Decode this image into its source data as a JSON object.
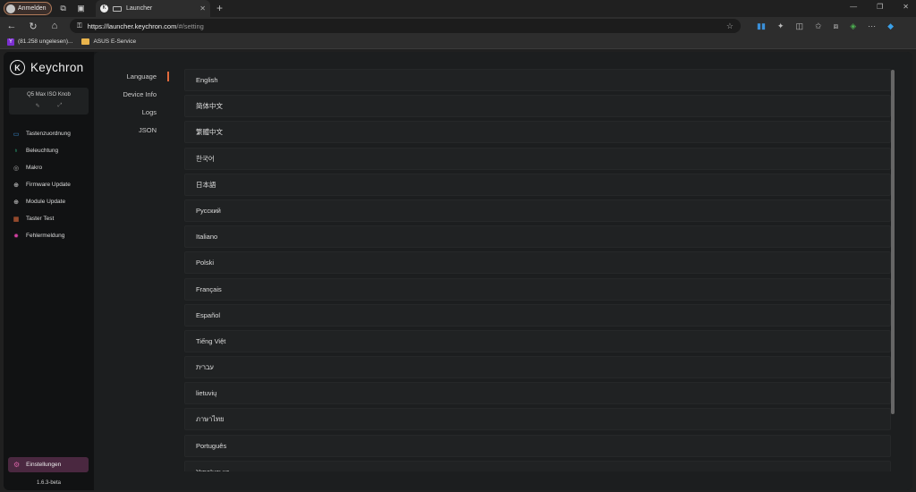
{
  "browser": {
    "profile_label": "Anmelden",
    "tab_title": "Launcher",
    "url_host": "https://launcher.keychron.com",
    "url_path": "/#/setting",
    "bookmarks": [
      {
        "label": "(81.258 ungelesen)..."
      },
      {
        "label": "ASUS E-Service"
      }
    ]
  },
  "app": {
    "logo_text": "Keychron",
    "device_name": "Q5 Max ISO Knob",
    "menu": [
      {
        "label": "Tastenzuordnung",
        "icon": "keyboard-icon",
        "color": "#3a8fd8"
      },
      {
        "label": "Beleuchtung",
        "icon": "bulb-icon",
        "color": "#2fbf8a"
      },
      {
        "label": "Makro",
        "icon": "macro-icon",
        "color": "#aaaaaa"
      },
      {
        "label": "Firmware Update",
        "icon": "plus-circle-icon",
        "color": "#dddddd"
      },
      {
        "label": "Module Update",
        "icon": "plus-circle-icon",
        "color": "#dddddd"
      },
      {
        "label": "Taster Test",
        "icon": "calendar-icon",
        "color": "#e06a3c"
      },
      {
        "label": "Fehlermeldung",
        "icon": "bug-icon",
        "color": "#d040a0"
      }
    ],
    "settings_label": "Einstellungen",
    "version": "1.6.3-beta",
    "subnav": [
      {
        "label": "Language",
        "active": true
      },
      {
        "label": "Device Info",
        "active": false
      },
      {
        "label": "Logs",
        "active": false
      },
      {
        "label": "JSON",
        "active": false
      }
    ],
    "languages": [
      "English",
      "简体中文",
      "繁體中文",
      "한국어",
      "日本語",
      "Русский",
      "Italiano",
      "Polski",
      "Français",
      "Español",
      "Tiếng Việt",
      "עברית",
      "lietuvių",
      "ภาษาไทย",
      "Português",
      "Українська"
    ]
  }
}
